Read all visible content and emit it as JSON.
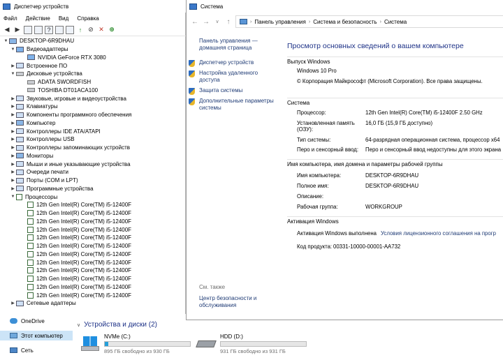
{
  "device_manager": {
    "title": "Диспетчер устройств",
    "menu": [
      "Файл",
      "Действие",
      "Вид",
      "Справка"
    ],
    "tree": [
      {
        "level": 0,
        "arrow": "▼",
        "icon": "pc",
        "label": "DESKTOP-6R9DHAU"
      },
      {
        "level": 1,
        "arrow": "▼",
        "icon": "gpu",
        "label": "Видеоадаптеры"
      },
      {
        "level": 2,
        "arrow": "",
        "icon": "gpu",
        "label": "NVIDIA GeForce RTX 3080"
      },
      {
        "level": 1,
        "arrow": "▶",
        "icon": "gen",
        "label": "Встроенное ПО"
      },
      {
        "level": 1,
        "arrow": "▼",
        "icon": "disk",
        "label": "Дисковые устройства"
      },
      {
        "level": 2,
        "arrow": "",
        "icon": "disk",
        "label": "ADATA SWORDFISH"
      },
      {
        "level": 2,
        "arrow": "",
        "icon": "disk",
        "label": "TOSHIBA DT01ACA100"
      },
      {
        "level": 1,
        "arrow": "▶",
        "icon": "gen",
        "label": "Звуковые, игровые и видеоустройства"
      },
      {
        "level": 1,
        "arrow": "▶",
        "icon": "gen",
        "label": "Клавиатуры"
      },
      {
        "level": 1,
        "arrow": "▶",
        "icon": "gen",
        "label": "Компоненты программного обеспечения"
      },
      {
        "level": 1,
        "arrow": "▶",
        "icon": "pc",
        "label": "Компьютер"
      },
      {
        "level": 1,
        "arrow": "▶",
        "icon": "gen",
        "label": "Контроллеры IDE ATA/ATAPI"
      },
      {
        "level": 1,
        "arrow": "▶",
        "icon": "gen",
        "label": "Контроллеры USB"
      },
      {
        "level": 1,
        "arrow": "▶",
        "icon": "gen",
        "label": "Контроллеры запоминающих устройств"
      },
      {
        "level": 1,
        "arrow": "▶",
        "icon": "pc",
        "label": "Мониторы"
      },
      {
        "level": 1,
        "arrow": "▶",
        "icon": "gen",
        "label": "Мыши и иные указывающие устройства"
      },
      {
        "level": 1,
        "arrow": "▶",
        "icon": "gen",
        "label": "Очереди печати"
      },
      {
        "level": 1,
        "arrow": "▶",
        "icon": "gen",
        "label": "Порты (COM и LPT)"
      },
      {
        "level": 1,
        "arrow": "▶",
        "icon": "gen",
        "label": "Программные устройства"
      },
      {
        "level": 1,
        "arrow": "▼",
        "icon": "cpu",
        "label": "Процессоры"
      },
      {
        "level": 2,
        "arrow": "",
        "icon": "cpu",
        "label": "12th Gen Intel(R) Core(TM) i5-12400F"
      },
      {
        "level": 2,
        "arrow": "",
        "icon": "cpu",
        "label": "12th Gen Intel(R) Core(TM) i5-12400F"
      },
      {
        "level": 2,
        "arrow": "",
        "icon": "cpu",
        "label": "12th Gen Intel(R) Core(TM) i5-12400F"
      },
      {
        "level": 2,
        "arrow": "",
        "icon": "cpu",
        "label": "12th Gen Intel(R) Core(TM) i5-12400F"
      },
      {
        "level": 2,
        "arrow": "",
        "icon": "cpu",
        "label": "12th Gen Intel(R) Core(TM) i5-12400F"
      },
      {
        "level": 2,
        "arrow": "",
        "icon": "cpu",
        "label": "12th Gen Intel(R) Core(TM) i5-12400F"
      },
      {
        "level": 2,
        "arrow": "",
        "icon": "cpu",
        "label": "12th Gen Intel(R) Core(TM) i5-12400F"
      },
      {
        "level": 2,
        "arrow": "",
        "icon": "cpu",
        "label": "12th Gen Intel(R) Core(TM) i5-12400F"
      },
      {
        "level": 2,
        "arrow": "",
        "icon": "cpu",
        "label": "12th Gen Intel(R) Core(TM) i5-12400F"
      },
      {
        "level": 2,
        "arrow": "",
        "icon": "cpu",
        "label": "12th Gen Intel(R) Core(TM) i5-12400F"
      },
      {
        "level": 2,
        "arrow": "",
        "icon": "cpu",
        "label": "12th Gen Intel(R) Core(TM) i5-12400F"
      },
      {
        "level": 2,
        "arrow": "",
        "icon": "cpu",
        "label": "12th Gen Intel(R) Core(TM) i5-12400F"
      },
      {
        "level": 1,
        "arrow": "▶",
        "icon": "gen",
        "label": "Сетевые адаптеры"
      }
    ]
  },
  "explorer": {
    "nav": {
      "onedrive": "OneDrive",
      "thispc": "Этот компьютер",
      "network": "Сеть"
    },
    "devices_header": "Устройства и диски (2)",
    "drives": [
      {
        "name": "NVMe (C:)",
        "free": "895 ГБ свободно из 930 ГБ",
        "used_fraction": 0.04
      },
      {
        "name": "HDD (D:)",
        "free": "931 ГБ свободно из 931 ГБ",
        "used_fraction": 0.0
      }
    ]
  },
  "system": {
    "title": "Система",
    "breadcrumb": [
      "Панель управления",
      "Система и безопасность",
      "Система"
    ],
    "left_links": {
      "home": "Панель управления — домашняя страница",
      "devmgr": "Диспетчер устройств",
      "remote": "Настройка удаленного доступа",
      "protection": "Защита системы",
      "advanced": "Дополнительные параметры системы",
      "see_also": "См. также",
      "security": "Центр безопасности и обслуживания"
    },
    "heading": "Просмотр основных сведений о вашем компьютере",
    "edition": {
      "section": "Выпуск Windows",
      "name": "Windows 10 Pro",
      "copyright": "© Корпорация Майкрософт (Microsoft Corporation). Все права защищены."
    },
    "system_section": {
      "section": "Система",
      "cpu_label": "Процессор:",
      "cpu_value": "12th Gen Intel(R) Core(TM) i5-12400F   2.50 GHz",
      "ram_label": "Установленная память (ОЗУ):",
      "ram_value": "16,0 ГБ (15,9 ГБ доступно)",
      "type_label": "Тип системы:",
      "type_value": "64-разрядная операционная система, процессор x64",
      "pen_label": "Перо и сенсорный ввод:",
      "pen_value": "Перо и сенсорный ввод недоступны для этого экрана"
    },
    "name_section": {
      "section": "Имя компьютера, имя домена и параметры рабочей группы",
      "pcname_label": "Имя компьютера:",
      "pcname_value": "DESKTOP-6R9DHAU",
      "full_label": "Полное имя:",
      "full_value": "DESKTOP-6R9DHAU",
      "desc_label": "Описание:",
      "desc_value": "",
      "wg_label": "Рабочая группа:",
      "wg_value": "WORKGROUP"
    },
    "activation": {
      "section": "Активация Windows",
      "status": "Активация Windows выполнена",
      "license_link": "Условия лицензионного соглашения на прогр",
      "key_label": "Код продукта:",
      "key_value": "00331-10000-00001-AA732"
    }
  },
  "colors": {
    "link": "#1f3b75",
    "heading": "#1e3287",
    "selection": "#cce4f7",
    "drive_bar": "#26a0da"
  }
}
